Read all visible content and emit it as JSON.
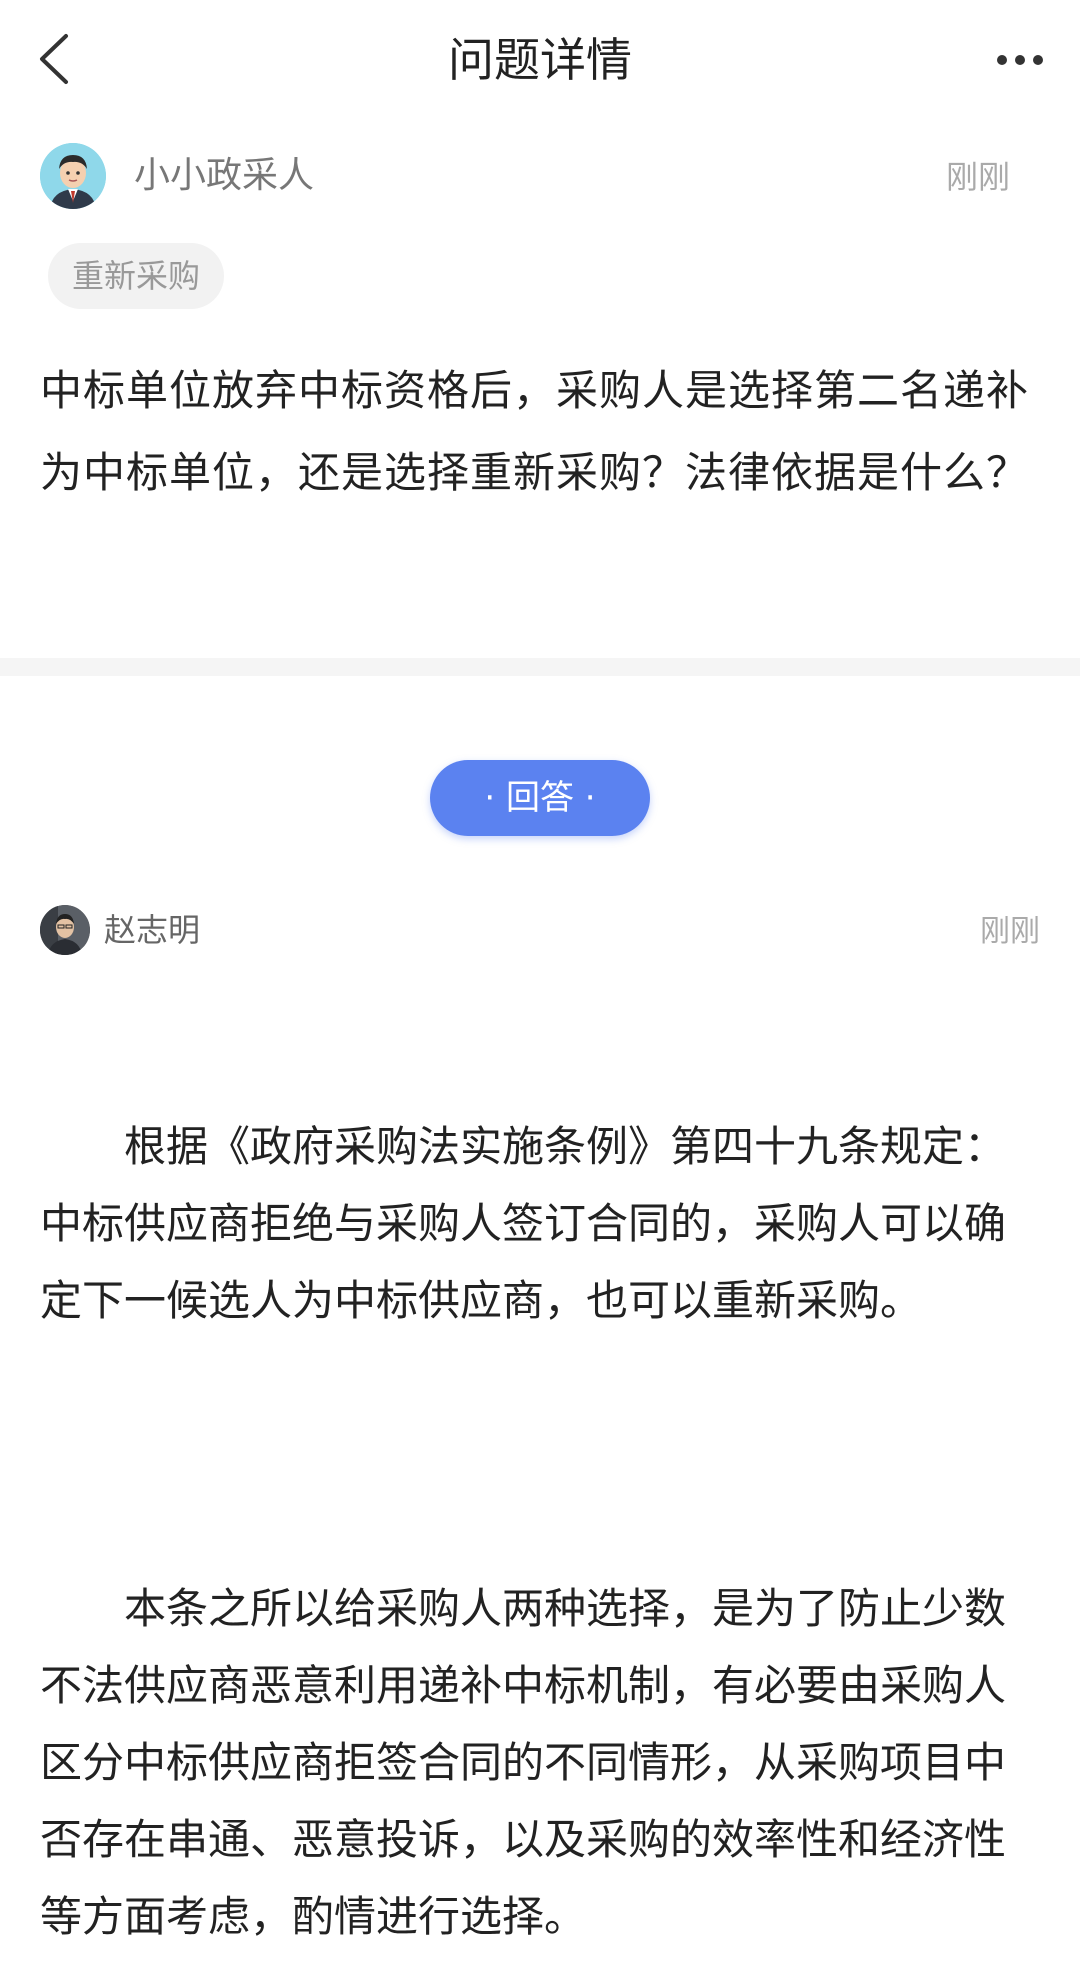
{
  "header": {
    "title": "问题详情",
    "back_icon": "chevron-left-icon",
    "more_icon": "more-horizontal-icon"
  },
  "question": {
    "author": "小小政采人",
    "time": "刚刚",
    "tag": "重新采购",
    "text": "中标单位放弃中标资格后，采购人是选择第二名递补为中标单位，还是选择重新采购？法律依据是什么？"
  },
  "answer_label": "· 回答 ·",
  "answer": {
    "author": "赵志明",
    "time": "刚刚",
    "paragraphs": [
      "根据《政府采购法实施条例》第四十九条规定：中标供应商拒绝与采购人签订合同的，采购人可以确定下一候选人为中标供应商，也可以重新采购。",
      "本条之所以给采购人两种选择，是为了防止少数不法供应商恶意利用递补中标机制，有必要由采购人区分中标供应商拒签合同的不同情形，从采购项目中否存在串通、恶意投诉，以及采购的效率性和经济性等方面考虑，酌情进行选择。"
    ]
  },
  "colors": {
    "accent": "#5b82f0",
    "text": "#222222",
    "muted": "#999999",
    "divider": "#f5f5f5"
  }
}
